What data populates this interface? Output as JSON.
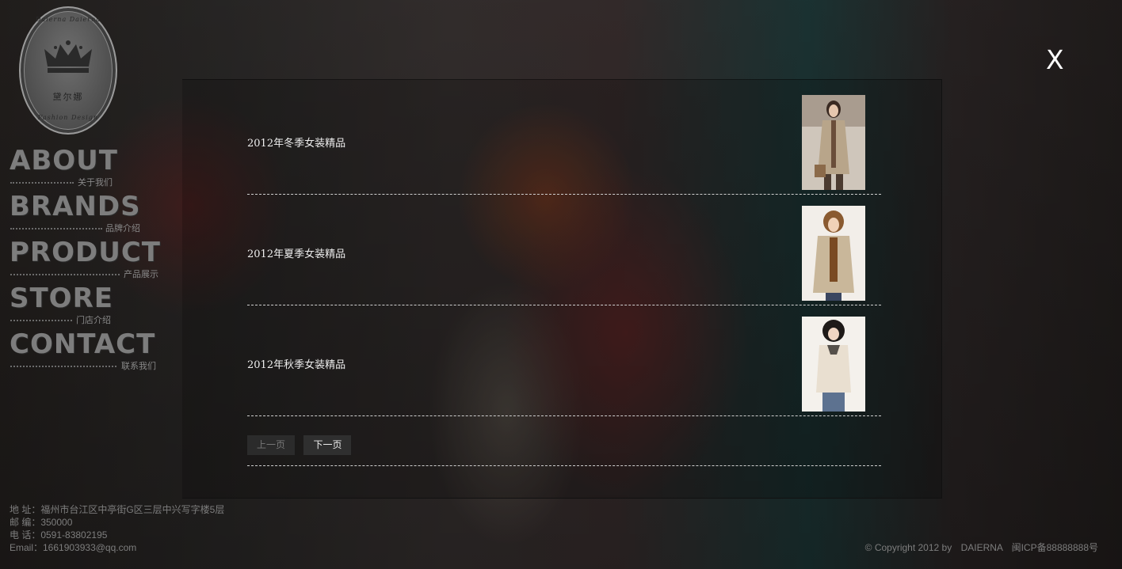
{
  "logo": {
    "brand_cn": "黛尔娜",
    "arc_top": "Daierna Daierna",
    "arc_bottom": "Fashion Design"
  },
  "nav": [
    {
      "en": "ABOUT",
      "cn": "关于我们"
    },
    {
      "en": "BRANDS",
      "cn": "品牌介绍"
    },
    {
      "en": "PRODUCT",
      "cn": "产品展示"
    },
    {
      "en": "STORE",
      "cn": "门店介绍"
    },
    {
      "en": "CONTACT",
      "cn": "联系我们"
    }
  ],
  "close_label": "X",
  "products": [
    {
      "title": "2012年冬季女装精品",
      "coat_color": "#b8a58a"
    },
    {
      "title": "2012年夏季女装精品",
      "coat_color": "#c9b79a"
    },
    {
      "title": "2012年秋季女装精品",
      "coat_color": "#e9dfd0"
    }
  ],
  "pager": {
    "prev": "上一页",
    "next": "下一页"
  },
  "contact": {
    "address": "地 址：福州市台江区中亭街G区三层中兴写字楼5层",
    "zip": "邮 编：350000",
    "phone": "电 话：0591-83802195",
    "email": "Email：1661903933@qq.com"
  },
  "copyright": {
    "text": "© Copyright 2012 by",
    "brand": "DAIERNA",
    "icp": "闽ICP备88888888号"
  }
}
